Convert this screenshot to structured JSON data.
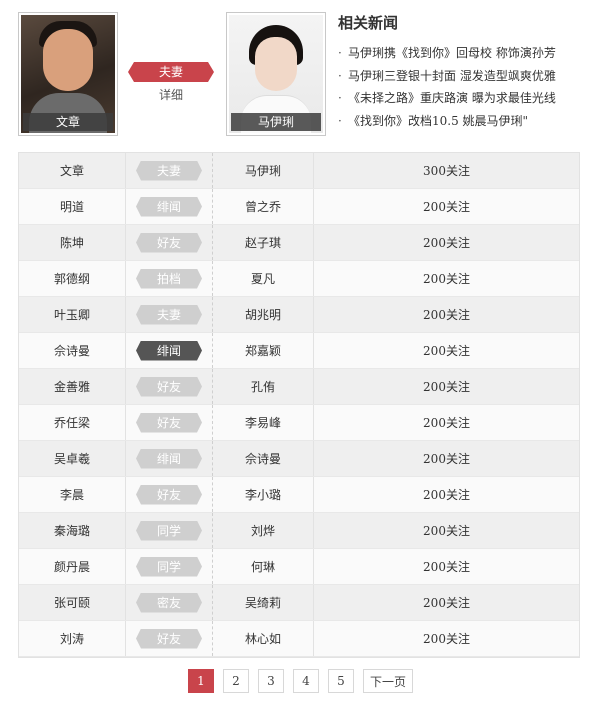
{
  "header": {
    "left_person": {
      "name": "文章"
    },
    "right_person": {
      "name": "马伊琍"
    },
    "relation": {
      "label": "夫妻",
      "detail": "详细"
    }
  },
  "news": {
    "title": "相关新闻",
    "items": [
      "马伊琍携《找到你》回母校 称饰演孙芳",
      "马伊琍三登银十封面 湿发造型飒爽优雅",
      "《未择之路》重庆路演 曝为求最佳光线",
      "《找到你》改档10.5 姚晨马伊琍\""
    ]
  },
  "table": {
    "rows": [
      {
        "a": "文章",
        "rel": "夫妻",
        "b": "马伊琍",
        "follow": "300关注",
        "active": false
      },
      {
        "a": "明道",
        "rel": "绯闻",
        "b": "曾之乔",
        "follow": "200关注",
        "active": false
      },
      {
        "a": "陈坤",
        "rel": "好友",
        "b": "赵子琪",
        "follow": "200关注",
        "active": false
      },
      {
        "a": "郭德纲",
        "rel": "拍档",
        "b": "夏凡",
        "follow": "200关注",
        "active": false
      },
      {
        "a": "叶玉卿",
        "rel": "夫妻",
        "b": "胡兆明",
        "follow": "200关注",
        "active": false
      },
      {
        "a": "佘诗曼",
        "rel": "绯闻",
        "b": "郑嘉颖",
        "follow": "200关注",
        "active": true
      },
      {
        "a": "金善雅",
        "rel": "好友",
        "b": "孔侑",
        "follow": "200关注",
        "active": false
      },
      {
        "a": "乔任梁",
        "rel": "好友",
        "b": "李易峰",
        "follow": "200关注",
        "active": false
      },
      {
        "a": "吴卓羲",
        "rel": "绯闻",
        "b": "佘诗曼",
        "follow": "200关注",
        "active": false
      },
      {
        "a": "李晨",
        "rel": "好友",
        "b": "李小璐",
        "follow": "200关注",
        "active": false
      },
      {
        "a": "秦海璐",
        "rel": "同学",
        "b": "刘烨",
        "follow": "200关注",
        "active": false
      },
      {
        "a": "颜丹晨",
        "rel": "同学",
        "b": "何琳",
        "follow": "200关注",
        "active": false
      },
      {
        "a": "张可颐",
        "rel": "密友",
        "b": "吴绮莉",
        "follow": "200关注",
        "active": false
      },
      {
        "a": "刘涛",
        "rel": "好友",
        "b": "林心如",
        "follow": "200关注",
        "active": false
      }
    ]
  },
  "pagination": {
    "pages": [
      "1",
      "2",
      "3",
      "4",
      "5"
    ],
    "current": "1",
    "next_label": "下一页"
  },
  "colors": {
    "accent": "#c9444b",
    "tag_inactive": "#cfcfcf",
    "tag_active": "#555555"
  }
}
